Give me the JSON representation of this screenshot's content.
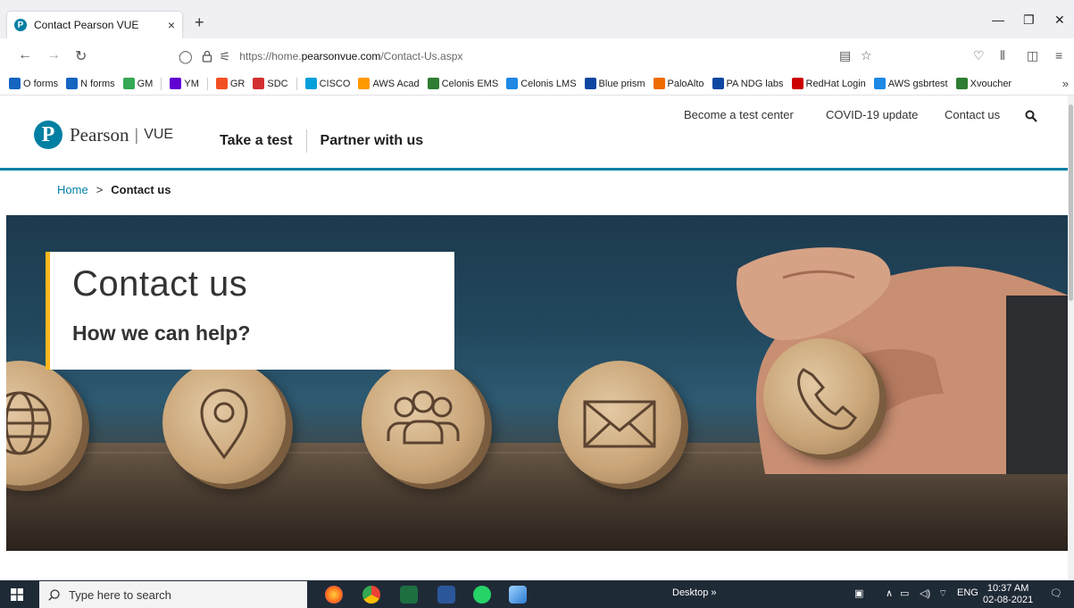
{
  "browser": {
    "tab_title": "Contact Pearson VUE",
    "tab_close": "×",
    "new_tab": "+",
    "url_prefix": "https://home.",
    "url_domain": "pearsonvue.com",
    "url_path": "/Contact-Us.aspx",
    "bookmarks": [
      {
        "label": "O forms",
        "color": "#1565c0"
      },
      {
        "label": "N forms",
        "color": "#1565c0"
      },
      {
        "label": "GM",
        "color": "#34a853"
      },
      {
        "label": "YM",
        "color": "#6001d2"
      },
      {
        "label": "GR",
        "color": "#f25022"
      },
      {
        "label": "SDC",
        "color": "#d32f2f"
      },
      {
        "label": "CISCO",
        "color": "#049fd9"
      },
      {
        "label": "AWS Acad",
        "color": "#ff9900"
      },
      {
        "label": "Celonis EMS",
        "color": "#2e7d32"
      },
      {
        "label": "Celonis LMS",
        "color": "#1e88e5"
      },
      {
        "label": "Blue prism",
        "color": "#0d47a1"
      },
      {
        "label": "PaloAlto",
        "color": "#ef6c00"
      },
      {
        "label": "PA NDG labs",
        "color": "#0d47a1"
      },
      {
        "label": "RedHat Login",
        "color": "#cc0000"
      },
      {
        "label": "AWS gsbrtest",
        "color": "#1e88e5"
      },
      {
        "label": "Xvoucher",
        "color": "#2e7d32"
      }
    ]
  },
  "site": {
    "brand": "Pearson",
    "brand_sep": "|",
    "brand_product": "VUE",
    "nav": [
      "Take a test",
      "Partner with us"
    ],
    "util_nav": [
      "Become a test center",
      "COVID-19 update",
      "Contact us"
    ],
    "breadcrumb": {
      "home": "Home",
      "sep": ">",
      "current": "Contact us"
    },
    "hero": {
      "title": "Contact us",
      "subtitle": "How we can help?"
    },
    "accent_color": "#007fa3",
    "card_accent": "#ffb81c"
  },
  "taskbar": {
    "search_placeholder": "Type here to search",
    "desktop_label": "Desktop",
    "desktop_chevron": "»",
    "language": "ENG",
    "time": "10:37 AM",
    "date": "02-08-2021"
  }
}
